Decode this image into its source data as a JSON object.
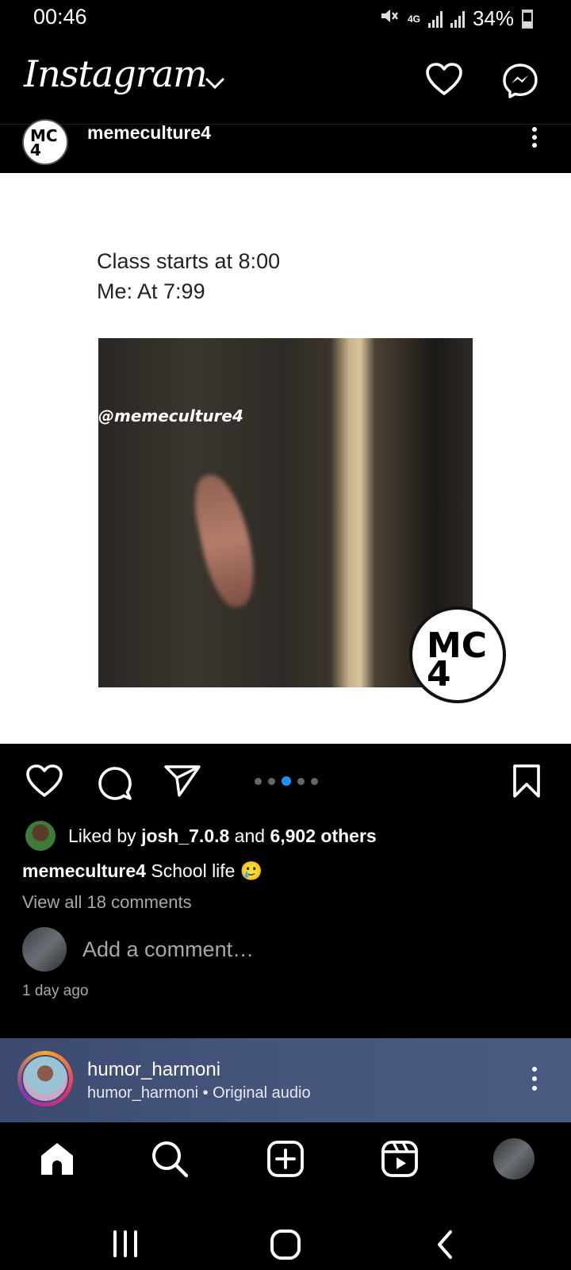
{
  "status_bar": {
    "time": "00:46",
    "network": "4G",
    "battery": "34%"
  },
  "header": {
    "title": "Instagram"
  },
  "post": {
    "username": "memeculture4",
    "avatar_text": "MC 4",
    "media": {
      "text_line1": "Class starts at 8:00",
      "text_line2": "Me: At 7:99",
      "watermark": "@memeculture4",
      "logo_text": "MC 4"
    },
    "carousel": {
      "count": 5,
      "active_index": 2
    },
    "likes": {
      "prefix": "Liked by ",
      "liker": "josh_7.0.8",
      "middle": " and ",
      "others": "6,902 others"
    },
    "caption": {
      "username": "memeculture4",
      "text": "School life 🥲"
    },
    "view_comments": "View all 18 comments",
    "add_comment_placeholder": "Add a comment…",
    "time_ago": "1 day ago"
  },
  "audio": {
    "username": "humor_harmoni",
    "subtitle": "humor_harmoni • Original audio"
  },
  "bottom_nav": [
    "home",
    "search",
    "create",
    "reels",
    "profile"
  ],
  "colors": {
    "accent_blue": "#1e90ff",
    "audio_bar": "#45557c",
    "background": "#000000"
  }
}
